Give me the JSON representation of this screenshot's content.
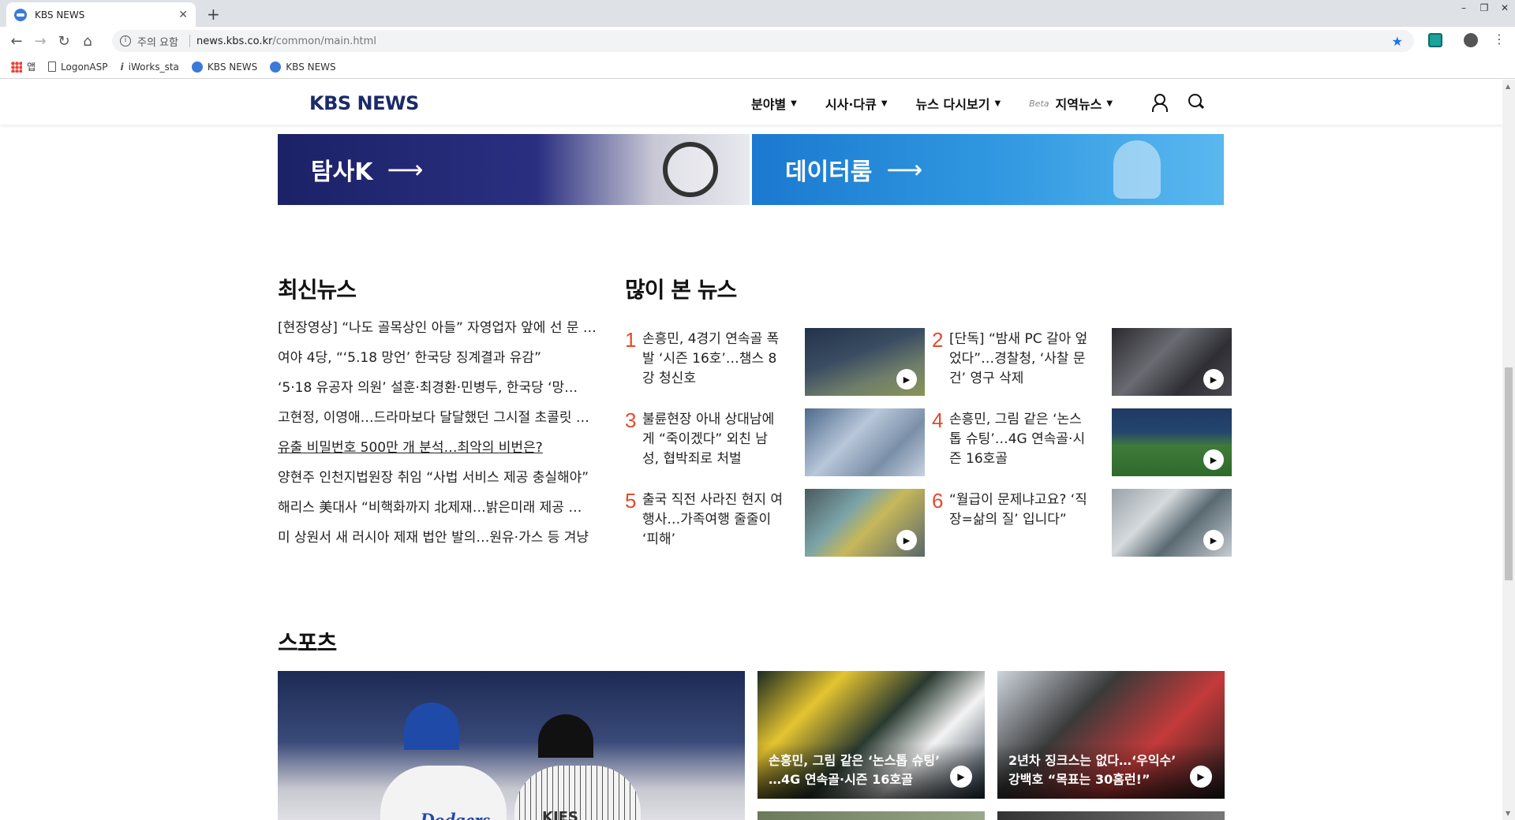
{
  "browser": {
    "tab_title": "KBS NEWS",
    "new_tab": "+",
    "window_controls": [
      "–",
      "❐",
      "✕"
    ],
    "url_warning": "주의 요함",
    "url_host": "news.kbs.co.kr",
    "url_path": "/common/main.html",
    "bookmarks": [
      {
        "label": "앱",
        "icon": "apps-icon"
      },
      {
        "label": "LogonASP",
        "icon": "file-icon"
      },
      {
        "label": "iWorks_sta",
        "icon": "iworks-icon"
      },
      {
        "label": "KBS NEWS",
        "icon": "kbs-icon"
      },
      {
        "label": "KBS NEWS",
        "icon": "kbs-icon"
      }
    ]
  },
  "site": {
    "logo": "KBS NEWS",
    "nav": [
      {
        "label": "분야별"
      },
      {
        "label": "시사·다큐"
      },
      {
        "label": "뉴스 다시보기"
      },
      {
        "label": "지역뉴스",
        "badge": "Beta"
      }
    ]
  },
  "banners": [
    {
      "label": "탐사K",
      "arrow": "⟶"
    },
    {
      "label": "데이터룸",
      "arrow": "⟶"
    }
  ],
  "latest": {
    "title": "최신뉴스",
    "items": [
      "[현장영상] “나도 골목상인 아들” 자영업자 앞에 선 문 …",
      "여야 4당, “‘5.18 망언’ 한국당 징계결과 유감”",
      "‘5·18 유공자 의원’ 설훈·최경환·민병두, 한국당 ‘망…",
      "고현정, 이영애…드라마보다 달달했던 그시절 초콜릿 …",
      "유출 비밀번호 500만 개 분석…최악의 비번은?",
      "양현주 인천지법원장 취임 “사법 서비스 제공 충실해야”",
      "해리스 美대사 “비핵화까지 北제재…밝은미래 제공 …",
      "미 상원서 새 러시아 제재 법안 발의…원유·가스 등 겨냥"
    ]
  },
  "popular": {
    "title": "많이 본 뉴스",
    "items": [
      {
        "rank": "1",
        "title": "손흥민, 4경기 연속골 폭발 ‘시즌 16호’…챔스 8강 청신호"
      },
      {
        "rank": "2",
        "title": "[단독] “밤새 PC 갈아 엎었다”…경찰청, ‘사찰 문건’ 영구 삭제"
      },
      {
        "rank": "3",
        "title": "불륜현장 아내 상대남에게 “죽이겠다” 외친 남성, 협박죄로 처벌"
      },
      {
        "rank": "4",
        "title": "손흥민, 그림 같은 ‘논스톱 슈팅’…4G 연속골·시즌 16호골"
      },
      {
        "rank": "5",
        "title": "출국 직전 사라진 현지 여행사…가족여행 줄줄이 ‘피해’"
      },
      {
        "rank": "6",
        "title": "“월급이 문제냐고요? ‘직장=삶의 질’ 입니다”"
      }
    ]
  },
  "sports": {
    "title": "스포츠",
    "hero_text_1": "Dodgers",
    "hero_text_2": "KIES",
    "cards": [
      {
        "caption": "손흥민, 그림 같은 ‘논스톱 슈팅’ …4G 연속골·시즌 16호골"
      },
      {
        "caption": "2년차 징크스는 없다…‘우익수’ 강백호 “목표는 30홈런!”"
      }
    ]
  },
  "icons": {
    "play": "▶"
  }
}
